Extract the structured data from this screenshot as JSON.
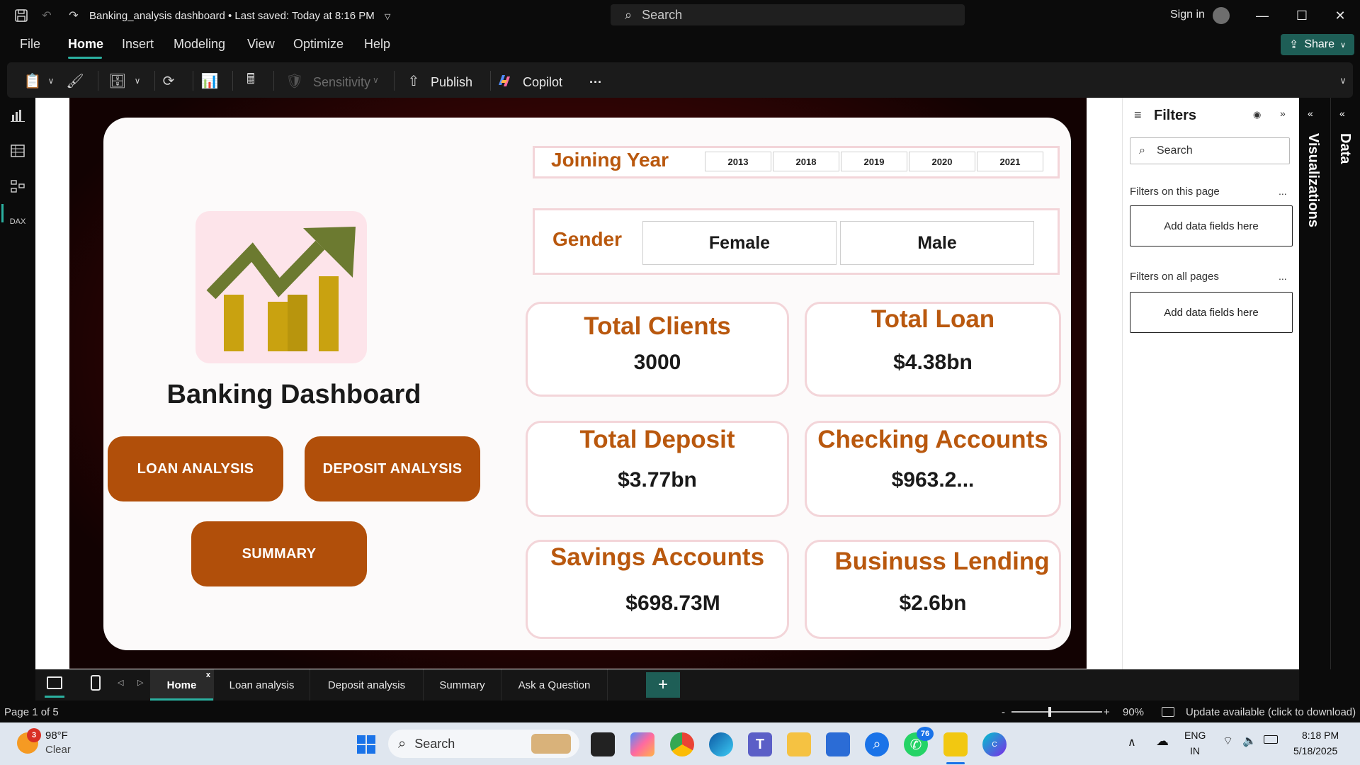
{
  "titlebar": {
    "doc_title": "Banking_analysis dashboard • Last saved: Today at 8:16 PM",
    "search_label": "Search",
    "signin": "Sign in"
  },
  "menu": {
    "file": "File",
    "home": "Home",
    "insert": "Insert",
    "modeling": "Modeling",
    "view": "View",
    "optimize": "Optimize",
    "help": "Help",
    "share": "Share"
  },
  "ribbon": {
    "sensitivity": "Sensitivity",
    "publish": "Publish",
    "copilot": "Copilot",
    "more": "···"
  },
  "report": {
    "title": "Banking Dashboard",
    "buttons": {
      "loan": "LOAN ANALYSIS",
      "deposit": "DEPOSIT ANALYSIS",
      "summary": "SUMMARY"
    },
    "joining_year": {
      "label": "Joining Year",
      "years": [
        "2013",
        "2018",
        "2019",
        "2020",
        "2021"
      ]
    },
    "gender": {
      "label": "Gender",
      "options": [
        "Female",
        "Male"
      ]
    },
    "kpis": {
      "total_clients": {
        "label": "Total Clients",
        "value": "3000"
      },
      "total_loan": {
        "label": "Total Loan",
        "value": "$4.38bn"
      },
      "total_deposit": {
        "label": "Total Deposit",
        "value": "$3.77bn"
      },
      "checking_accounts": {
        "label": "Checking Accounts",
        "value": "$963.2..."
      },
      "savings_accounts": {
        "label": "Savings Accounts",
        "value": "$698.73M"
      },
      "business_lending": {
        "label": "Businuss Lending",
        "value": "$2.6bn"
      }
    }
  },
  "filters": {
    "title": "Filters",
    "search_placeholder": "Search",
    "on_this_page": "Filters on this page",
    "on_all_pages": "Filters on all pages",
    "drop_label": "Add data fields here",
    "more": "..."
  },
  "side_panes": {
    "visualizations": "Visualizations",
    "data": "Data"
  },
  "page_tabs": {
    "tabs": [
      "Home",
      "Loan analysis",
      "Deposit analysis",
      "Summary",
      "Ask a Question"
    ],
    "active": "Home",
    "close": "x",
    "add": "+"
  },
  "status": {
    "page": "Page 1 of 5",
    "zoom_minus": "-",
    "zoom_plus": "+",
    "zoom": "90%",
    "update": "Update available (click to download)"
  },
  "taskbar": {
    "weather_temp": "98°F",
    "weather_cond": "Clear",
    "weather_badge": "3",
    "search": "Search",
    "whatsapp_badge": "76",
    "lang_top": "ENG",
    "lang_bottom": "IN",
    "time": "8:18 PM",
    "date": "5/18/2025"
  },
  "colors": {
    "accent_teal": "#2bb0a0",
    "brand_orange": "#b14f0a",
    "kpi_label": "#b9580e",
    "report_bg": "#8a0a0a"
  }
}
